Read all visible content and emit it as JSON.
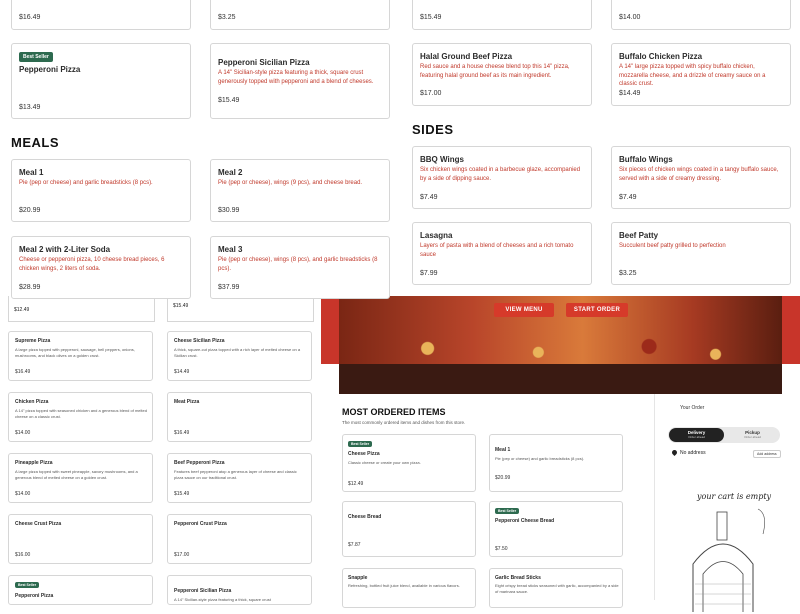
{
  "overlay": {
    "row0": [
      {
        "price": "$16.49"
      },
      {
        "price": "$3.25"
      },
      {
        "desc": "$15.49 ...",
        "price": "$15.49"
      },
      {
        "price": "$14.00"
      }
    ],
    "pizzas": [
      {
        "badge": "Best Seller",
        "name": "Pepperoni Pizza",
        "desc": "",
        "price": "$13.49"
      },
      {
        "name": "Pepperoni Sicilian Pizza",
        "desc": "A 14\" Sicilian-style pizza featuring a thick, square crust generously topped with pepperoni and a blend of cheeses.",
        "price": "$15.49"
      },
      {
        "name": "Halal Ground Beef Pizza",
        "desc": "Red sauce and a house cheese blend top this 14\" pizza, featuring halal ground beef as its main ingredient.",
        "price": "$17.00"
      },
      {
        "name": "Buffalo Chicken Pizza",
        "desc": "A 14\" large pizza topped with spicy buffalo chicken, mozzarella cheese, and a drizzle of creamy sauce on a classic crust.",
        "price": "$14.49"
      }
    ],
    "meals_heading": "MEALS",
    "sides_heading": "SIDES",
    "meals": [
      {
        "name": "Meal 1",
        "desc": "Pie (pep or cheese) and garlic breadsticks (8 pcs).",
        "price": "$20.99"
      },
      {
        "name": "Meal 2",
        "desc": "Pie (pep or cheese), wings (9 pcs), and cheese bread.",
        "price": "$30.99"
      },
      {
        "name": "Meal 2 with 2-Liter Soda",
        "desc": "Cheese or pepperoni pizza, 10 cheese bread pieces, 6 chicken wings, 2 liters of soda.",
        "price": "$28.99"
      },
      {
        "name": "Meal 3",
        "desc": "Pie (pep or cheese), wings (8 pcs), and garlic breadsticks (8 pcs).",
        "price": "$37.99"
      }
    ],
    "sides": [
      {
        "name": "BBQ Wings",
        "desc": "Six chicken wings coated in a barbecue glaze, accompanied by a side of dipping sauce.",
        "price": "$7.49"
      },
      {
        "name": "Buffalo Wings",
        "desc": "Six pieces of chicken wings coated in a tangy buffalo sauce, served with a side of creamy dressing.",
        "price": "$7.49"
      },
      {
        "name": "Lasagna",
        "desc": "Layers of pasta with a blend of cheeses and a rich tomato sauce",
        "price": "$7.99"
      },
      {
        "name": "Beef Patty",
        "desc": "Succulent beef patty grilled to perfection",
        "price": "$3.25"
      }
    ]
  },
  "under": {
    "prices_top": [
      "$12.49",
      "$15.49"
    ],
    "left_list": [
      {
        "name": "Supreme Pizza",
        "desc": "A large pizza topped with pepperoni, sausage, bell peppers, onions, mushrooms, and black olives on a golden crust.",
        "price": "$16.49"
      },
      {
        "name": "Cheese Sicilian Pizza",
        "desc": "A thick, square-cut pizza topped with a rich layer of melted cheese on a Sicilian crust.",
        "price": "$14.49"
      },
      {
        "name": "Chicken Pizza",
        "desc": "A 14\" pizza topped with seasoned chicken and a generous blend of melted cheese on a classic crust.",
        "price": "$14.00"
      },
      {
        "name": "Meat Pizza",
        "desc": "",
        "price": "$16.49"
      },
      {
        "name": "Pineapple Pizza",
        "desc": "A large pizza topped with sweet pineapple, savory mushrooms, and a generous blend of melted cheese on a golden crust.",
        "price": "$14.00"
      },
      {
        "name": "Beef Pepperoni Pizza",
        "desc": "Features beef pepperoni atop a generous layer of cheese and classic pizza sauce on our traditional crust.",
        "price": "$15.49"
      },
      {
        "name": "Cheese Crust Pizza",
        "desc": "",
        "price": "$16.00"
      },
      {
        "name": "Pepperoni Crust Pizza",
        "desc": "",
        "price": "$17.00"
      },
      {
        "badge": "Best Seller",
        "name": "Pepperoni Pizza",
        "desc": "",
        "price": ""
      },
      {
        "name": "Pepperoni Sicilian Pizza",
        "desc": "A 14\" Sicilian-style pizza featuring a thick, square crust",
        "price": ""
      }
    ],
    "hero": {
      "view_menu": "VIEW MENU",
      "start_order": "START ORDER"
    },
    "most_ordered": {
      "title": "MOST ORDERED ITEMS",
      "subtitle": "The most commonly ordered items and dishes from this store.",
      "items": [
        {
          "badge": "Best Seller",
          "name": "Cheese Pizza",
          "desc": "Classic cheese or create your own pizza.",
          "price": "$12.49"
        },
        {
          "name": "Meal 1",
          "desc": "Pie (pep or cheese) and garlic breadsticks (8 pcs).",
          "price": "$20.99"
        },
        {
          "name": "Cheese Bread",
          "desc": "",
          "price": "$7.87"
        },
        {
          "badge": "Best Seller",
          "name": "Pepperoni Cheese Bread",
          "desc": "",
          "price": "$7.50"
        },
        {
          "name": "Snapple",
          "desc": "Refreshing, bottled fruit juice blend, available in various flavors.",
          "price": ""
        },
        {
          "name": "Garlic Bread Sticks",
          "desc": "Eight crispy bread sticks seasoned with garlic, accompanied by a side of marinara sauce.",
          "price": ""
        }
      ]
    },
    "order": {
      "title": "Your Order",
      "delivery": "Delivery",
      "delivery_sub": "Order ahead",
      "pickup": "Pickup",
      "pickup_sub": "Order ahead",
      "no_address": "No address",
      "add_address": "Add address",
      "empty": "your cart is empty"
    }
  },
  "colors": {
    "accent": "#d63a2a",
    "badge": "#2d6a4f",
    "desc": "#c0392b"
  }
}
